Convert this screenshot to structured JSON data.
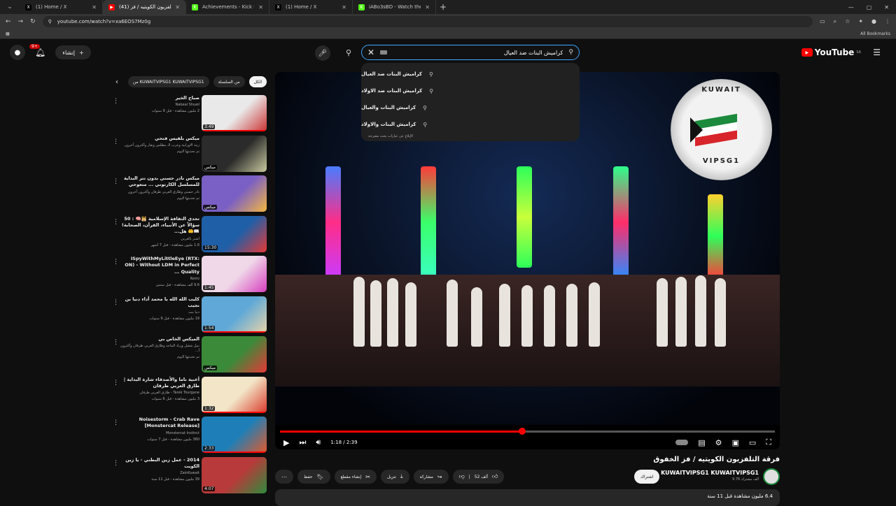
{
  "browser": {
    "tabs": [
      {
        "title": "(1) Home / X",
        "favicon": "X",
        "color": "#000000",
        "active": false
      },
      {
        "title": "(41) فرقة التلفزيون الكويتيه / فز",
        "favicon": "▶",
        "color": "#ff0000",
        "active": true
      },
      {
        "title": "Achievements - Kick Dashboard",
        "favicon": "K",
        "color": "#53fc18",
        "active": false
      },
      {
        "title": "(1) Home / X",
        "favicon": "X",
        "color": "#000000",
        "active": false
      },
      {
        "title": "iABo3sBD - Watch the VOD on",
        "favicon": "K",
        "color": "#53fc18",
        "active": false
      }
    ],
    "url": "youtube.com/watch?v=xa6EOS7Mz0g",
    "all_bookmarks": "All Bookmarks"
  },
  "header": {
    "create_label": "إنشاء",
    "notification_count": "9+",
    "search_query": "كراميش البنات ضد العيال",
    "logo_text": "YouTube",
    "logo_region": "SA"
  },
  "suggestions": [
    "كراميش البنات ضد العيال",
    "كراميش البنات ضد الاولاد",
    "كراميش البنات والعيال",
    "كراميش البنات والاولاد"
  ],
  "suggestion_note": "الإبلاغ عن عبارات بحث مقترحة",
  "player": {
    "time": "1:18 / 2:39",
    "progress_fraction": 0.49,
    "emblem_top": "KUWAIT",
    "emblem_bottom": "VIPSG1"
  },
  "video": {
    "title": "فرقة التلفزيون الكويتيه / فز الخفوق",
    "channel": "KUWAITVIPSG1 KUWAITVIPSG1",
    "subscribers": "9.76 ألف مشترك",
    "subscribe_label": "اشتراك",
    "like_count": "52 ألف",
    "actions": {
      "share": "مشاركة",
      "download": "تنزيل",
      "clip": "إنشاء مقطع",
      "save": "حفظ"
    },
    "views": "6.4 مليون مشاهدة",
    "age": "قبل 11 سنة"
  },
  "chips": {
    "all": "الكل",
    "series": "من السلسلة",
    "channel": "من KUWAITVIPSG1 KUWAITVIPSG1"
  },
  "recommendations": [
    {
      "title": "صباح الخير",
      "channel": "Nabeal Shuail",
      "meta": "2 مليون مشاهدة - قبل 9 سنوات",
      "duration": "3:49",
      "bg": "#e9e9e9",
      "accent": "#cc3333",
      "progress": true
    },
    {
      "title": "ميكس بلقيس فتحي",
      "channel": "زينة الاورابية وعرب الـ مطلس وبقار وأكثرون آخرون",
      "meta": "تم تحديثها اليوم",
      "duration": "ميكس",
      "bg": "#2b2b2b",
      "accent": "#c9c9a0",
      "progress": false
    },
    {
      "title": "ميكس نادر حسني بدون تتر البداية للمسلسل الكارتوني ... منعوحي",
      "channel": "نادر حسني وطارق العربي طرقان وأكثرون آخرون",
      "meta": "تم تحديثها اليوم",
      "duration": "ميكس",
      "bg": "#7a5fc4",
      "accent": "#f5b642",
      "progress": false
    },
    {
      "title": "تحدي الثقافة الإسلامية 🕌🧠 : 50 سؤالاً عن الأنبياء، القرآن، الصحابة! 📖🤲 هل...",
      "channel": "اشتر بالعربي",
      "meta": "1.6 مليون مشاهدة - قبل 7 أشهر",
      "duration": "15:30",
      "bg": "#1f5fa8",
      "accent": "#e53935",
      "progress": false
    },
    {
      "title": "ISpyWithMyLittleEye (RTX: ON) - Without LDM in Perfect Quality ...",
      "channel": "Neiro",
      "meta": "9.6 ألف مشاهدة - قبل سنتين",
      "duration": "1:45",
      "bg": "#f0d8e8",
      "accent": "#d63fbf",
      "progress": false
    },
    {
      "title": "كليب الله الله يا محمد أداء دنيا بن نجيب",
      "channel": "دنيا بنت",
      "meta": "19 مليون مشاهدة - قبل 9 سنوات",
      "duration": "1:54",
      "bg": "#5fa8d8",
      "accent": "#e8d4a8",
      "progress": true
    },
    {
      "title": "الميكس الخاص بي",
      "channel": "نبيل شعيل وزياد الماجد وطارق العربي طرقان وأكثرون آ...",
      "meta": "تم تحديثها اليوم",
      "duration": "ميكس",
      "bg": "#3a8a3a",
      "accent": "#e53935",
      "progress": false
    },
    {
      "title": "أغنية ناما والأصدقاء شارة البداية | طارق العربي طرقان",
      "channel": "Tarek Tourgane - طارق العربي طرقان",
      "meta": "3 مليون مشاهدة - قبل 6 سنوات",
      "duration": "1:32",
      "bg": "#f3e6c8",
      "accent": "#d93b2b",
      "progress": true
    },
    {
      "title": "Noisestorm - Crab Rave [Monstercat Release]",
      "channel": "Monstercat Instinct",
      "meta": "360 مليون مشاهدة - قبل 7 سنوات",
      "duration": "2:33",
      "bg": "#1e7fb8",
      "accent": "#e05a2b",
      "progress": true
    },
    {
      "title": "2014 - عمل زين البطني - يا زين الكويت",
      "channel": "ZainKuwait",
      "meta": "39 مليون مشاهدة - قبل 11 سنة",
      "duration": "4:07",
      "bg": "#b83a3a",
      "accent": "#2e8b3c",
      "progress": false
    }
  ]
}
